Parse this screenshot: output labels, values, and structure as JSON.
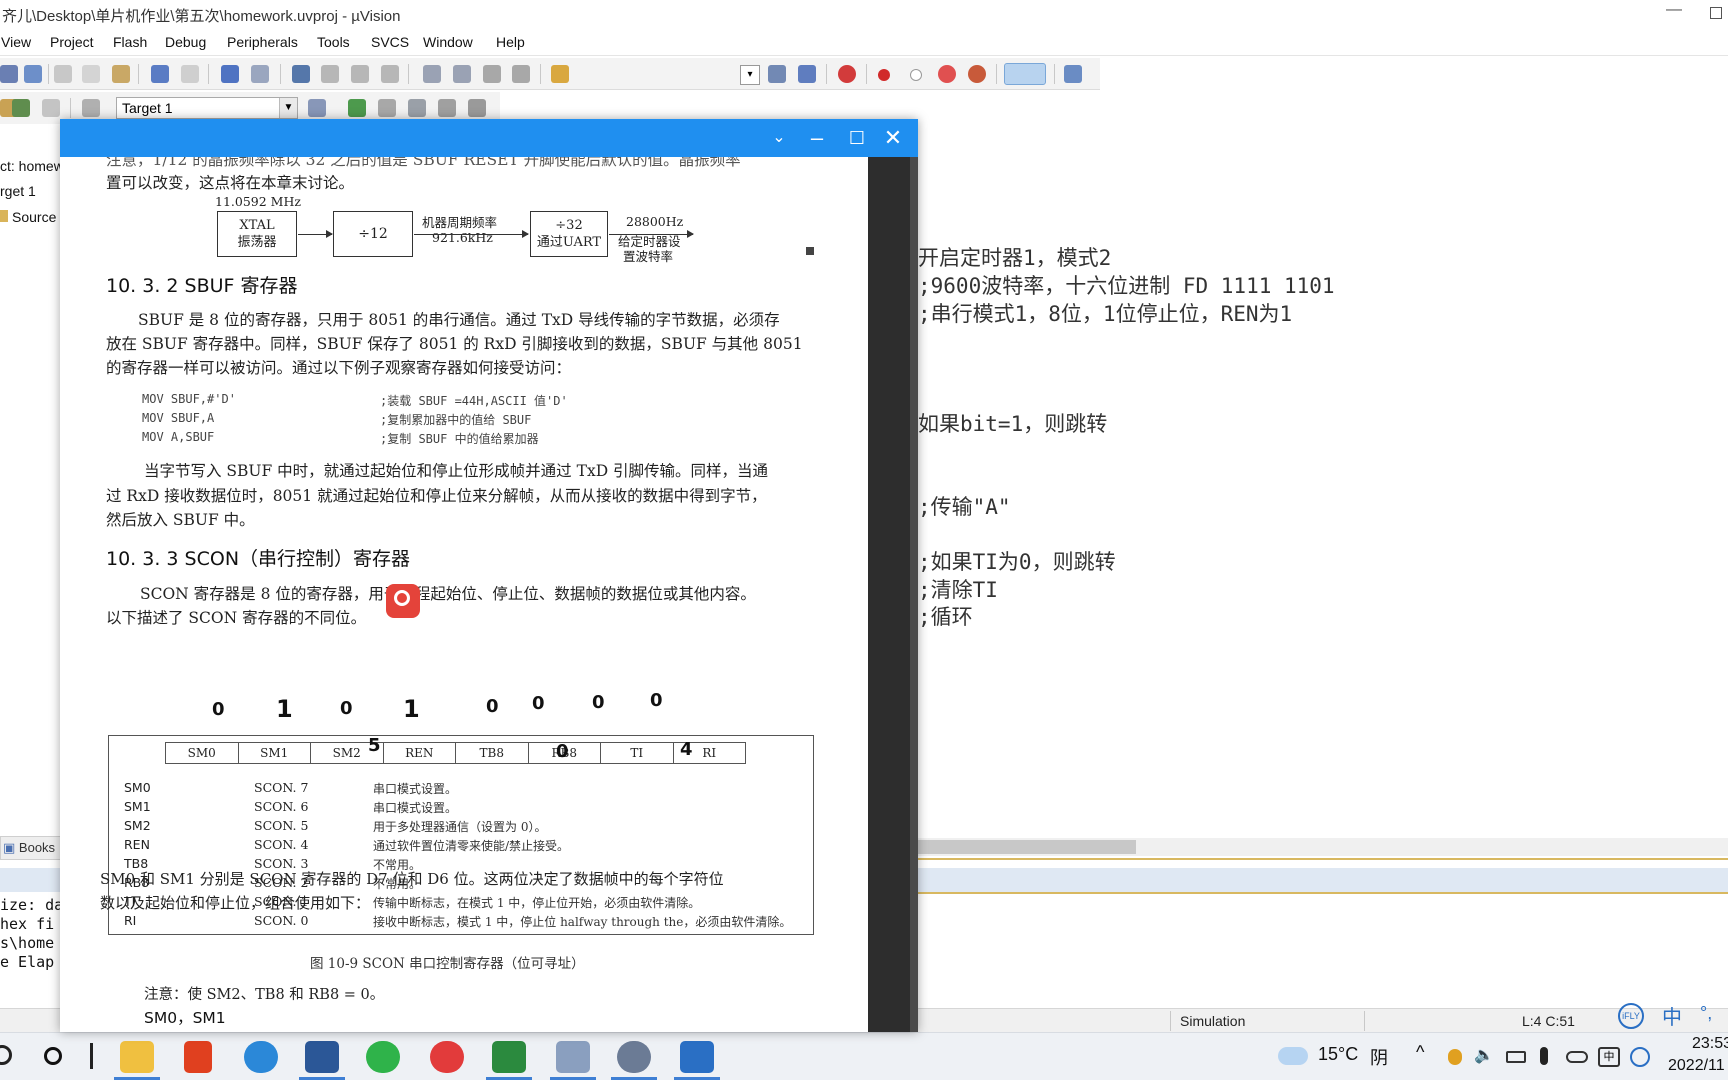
{
  "window": {
    "title": "齐儿\\Desktop\\单片机作业\\第五次\\homework.uvproj - µVision",
    "minimize_glyph": "—"
  },
  "menu": [
    "View",
    "Project",
    "Flash",
    "Debug",
    "Peripherals",
    "Tools",
    "SVCS",
    "Window",
    "Help"
  ],
  "toolbar": {
    "target": "Target 1"
  },
  "project_pane": {
    "project": "ct: homew",
    "target": "rget 1",
    "group": "Source",
    "books_tab": "Books"
  },
  "editor": {
    "lines": [
      "开启定时器1，模式2",
      ";9600波特率，十六位进制 FD 1111 1101",
      ";串行模式1，8位，1位停止位，REN为1",
      "如果bit=1，则跳转",
      ";传输\"A\"",
      ";如果TI为0，则跳转",
      ";清除TI",
      ";循环"
    ]
  },
  "build_output": [
    "ize: da",
    "hex fi",
    "s\\home",
    "e Elap"
  ],
  "statusbar": {
    "mode": "Simulation",
    "position": "L:4 C:51"
  },
  "ime": {
    "label": "中"
  },
  "taskbar": {
    "weather_temp": "15°C",
    "weather_desc": "阴",
    "time": "23:53",
    "date": "2022/11"
  },
  "pdf": {
    "top_partial": "注意，1/12 的晶振频率除以 32 之后的值是 SBUF RESET 开脚使能后默认的值。晶振频率",
    "top_line2": "置可以改变，这点将在本章末讨论。",
    "diagram": {
      "freq_in": "11.0592 MHz",
      "xtal_line1": "XTAL",
      "xtal_line2": "振荡器",
      "div12": "÷12",
      "mid_line1": "机器周期频率",
      "mid_line2": "921.6kHz",
      "div32_line1": "÷32",
      "div32_line2": "通过UART",
      "out_line1": "28800Hz",
      "out_line2": "给定时器设",
      "out_line3": "置波特率"
    },
    "sec1_title": "10. 3. 2    SBUF 寄存器",
    "sec1_p1": [
      "SBUF 是 8 位的寄存器，只用于 8051 的串行通信。通过 TxD 导线传输的字节数据，必须存",
      "放在 SBUF 寄存器中。同样，SBUF 保存了 8051 的 RxD 引脚接收到的数据，SBUF 与其他 8051",
      "的寄存器一样可以被访问。通过以下例子观察寄存器如何接受访问："
    ],
    "code": [
      {
        "instr": "MOV   SBUF,#'D'",
        "comment": ";装载 SBUF =44H,ASCII 值'D'"
      },
      {
        "instr": "MOV   SBUF,A",
        "comment": ";复制累加器中的值给 SBUF"
      },
      {
        "instr": "MOV   A,SBUF",
        "comment": ";复制 SBUF 中的值给累加器"
      }
    ],
    "sec1_p2": [
      "当字节写入 SBUF 中时，就通过起始位和停止位形成帧并通过 TxD 引脚传输。同样，当通",
      "过 RxD 接收数据位时，8051 就通过起始位和停止位来分解帧，从而从接收的数据中得到字节，",
      "然后放入 SBUF 中。"
    ],
    "sec2_title": "10. 3. 3    SCON（串行控制）寄存器",
    "sec2_p1a": "SCON 寄存器是 8 位的寄存器，用于编程起始位、停止位、数据帧的数据位或其他内容。",
    "sec2_p1b": "以下描述了 SCON 寄存器的不同位。",
    "reg_bits": [
      "SM0",
      "SM1",
      "SM2",
      "REN",
      "TB8",
      "RB8",
      "TI",
      "RI"
    ],
    "reg_rows": [
      {
        "bit": "SM0",
        "scon": "SCON. 7",
        "desc": "串口模式设置。"
      },
      {
        "bit": "SM1",
        "scon": "SCON. 6",
        "desc": "串口模式设置。"
      },
      {
        "bit": "SM2",
        "scon": "SCON. 5",
        "desc": "用于多处理器通信（设置为 0）。"
      },
      {
        "bit": "REN",
        "scon": "SCON. 4",
        "desc": "通过软件置位清零来使能/禁止接受。"
      },
      {
        "bit": "TB8",
        "scon": "SCON. 3",
        "desc": "不常用。"
      },
      {
        "bit": "RB8",
        "scon": "SCON. 2",
        "desc": "不常用。"
      },
      {
        "bit": "TI",
        "scon": "SCON. 1",
        "desc": "传输中断标志，在模式 1 中，停止位开始，必须由软件清除。"
      },
      {
        "bit": "RI",
        "scon": "SCON. 0",
        "desc": "接收中断标志，模式 1 中，停止位 halfway through the，必须由软件清除。"
      }
    ],
    "fig_caption": "图 10-9    SCON 串口控制寄存器（位可寻址）",
    "note": "注意：使 SM2、TB8 和 RB8 = 0。",
    "sub_head": "SM0，SM1",
    "last_p": [
      "SM0 和 SM1 分别是 SCON 寄存器的 D7 位和 D6 位。这两位决定了数据帧中的每个字符位",
      "数以及起始位和停止位，组合使用如下："
    ],
    "handwritten": [
      "0",
      "1",
      "0",
      "1",
      "0",
      "0",
      "0",
      "0",
      "5",
      "0",
      "4"
    ]
  }
}
